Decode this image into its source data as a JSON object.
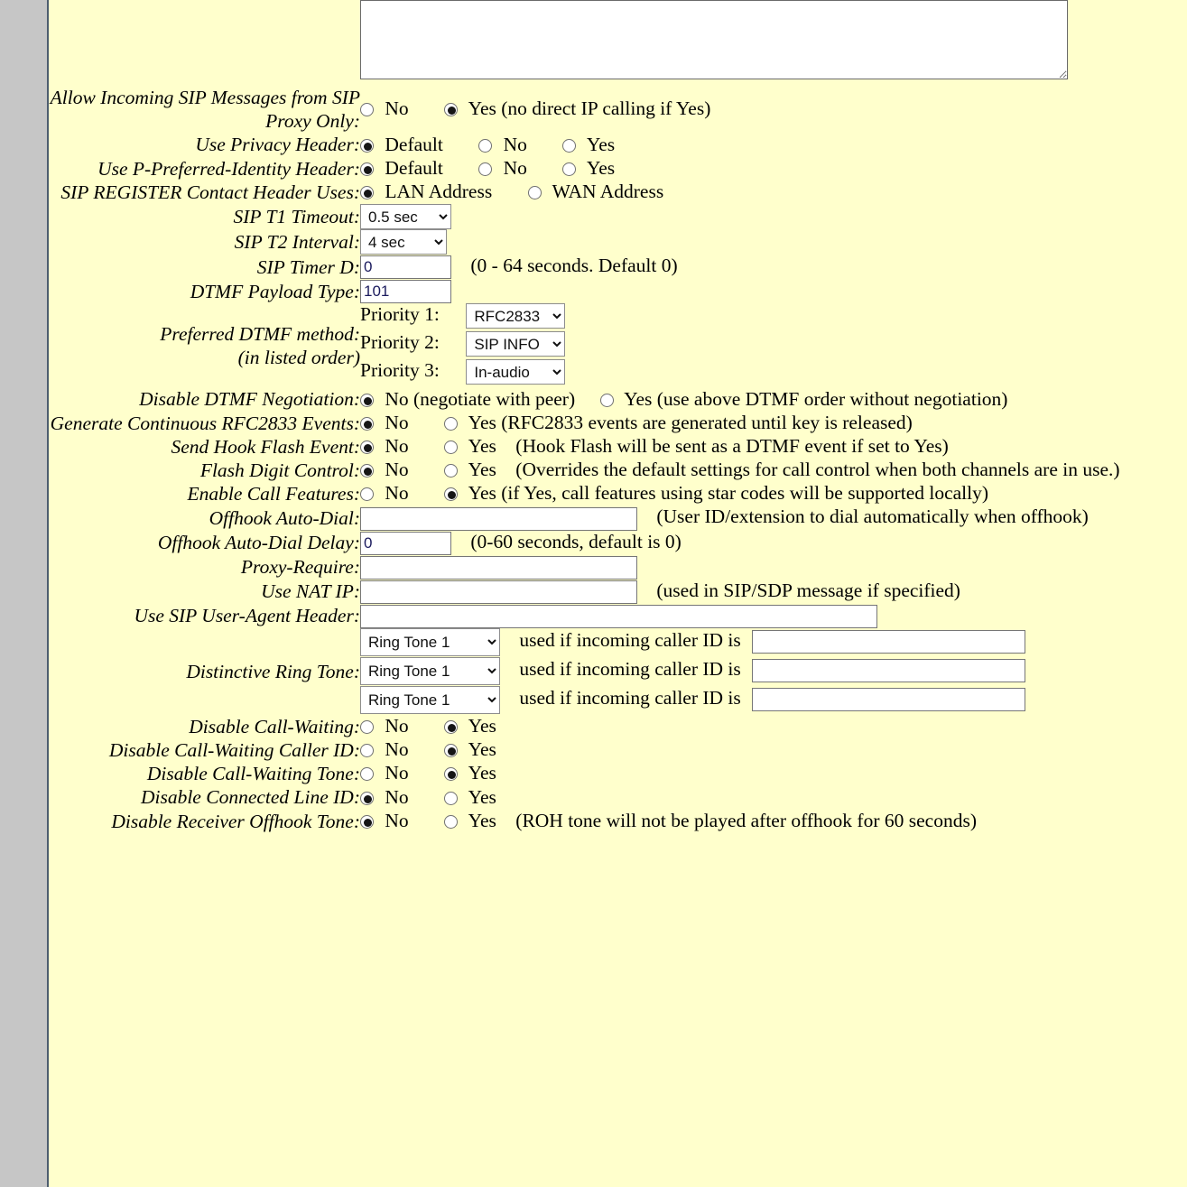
{
  "rows": {
    "allow_incoming": {
      "label": "Allow Incoming SIP Messages from SIP Proxy Only:",
      "no": "No",
      "yes": "Yes (no direct IP calling if Yes)"
    },
    "privacy_header": {
      "label": "Use Privacy Header:",
      "default": "Default",
      "no": "No",
      "yes": "Yes"
    },
    "ppi_header": {
      "label": "Use P-Preferred-Identity Header:",
      "default": "Default",
      "no": "No",
      "yes": "Yes"
    },
    "register_contact": {
      "label": "SIP REGISTER Contact Header Uses:",
      "lan": "LAN Address",
      "wan": "WAN Address"
    },
    "sip_t1": {
      "label": "SIP T1 Timeout:",
      "value": "0.5 sec"
    },
    "sip_t2": {
      "label": "SIP T2 Interval:",
      "value": "4 sec"
    },
    "sip_timer_d": {
      "label": "SIP Timer D:",
      "value": "0",
      "hint": "(0 - 64 seconds. Default 0)"
    },
    "dtmf_payload": {
      "label": "DTMF Payload Type:",
      "value": "101"
    },
    "preferred_dtmf": {
      "label": "Preferred DTMF method:",
      "label2": "(in listed order)",
      "priority1_label": "Priority 1:",
      "priority1_value": "RFC2833",
      "priority2_label": "Priority 2:",
      "priority2_value": "SIP INFO",
      "priority3_label": "Priority 3:",
      "priority3_value": "In-audio"
    },
    "disable_dtmf_neg": {
      "label": "Disable DTMF Negotiation:",
      "no": "No (negotiate with peer)",
      "yes": "Yes (use above DTMF order without negotiation)"
    },
    "continuous_rfc2833": {
      "label": "Generate Continuous RFC2833 Events:",
      "no": "No",
      "yes": "Yes (RFC2833 events are generated until key is released)"
    },
    "hook_flash": {
      "label": "Send Hook Flash Event:",
      "no": "No",
      "yes": "Yes",
      "hint": "(Hook Flash will be sent as a DTMF event if set to Yes)"
    },
    "flash_digit": {
      "label": "Flash Digit Control:",
      "no": "No",
      "yes": "Yes",
      "hint": "(Overrides the default settings for call control when both channels are in use.)"
    },
    "call_features": {
      "label": "Enable Call Features:",
      "no": "No",
      "yes": "Yes (if Yes, call features using star codes will be supported locally)"
    },
    "offhook_autodial": {
      "label": "Offhook Auto-Dial:",
      "value": "",
      "hint": "(User ID/extension to dial automatically when offhook)"
    },
    "offhook_delay": {
      "label": "Offhook Auto-Dial Delay:",
      "value": "0",
      "hint": "(0-60 seconds, default is 0)"
    },
    "proxy_require": {
      "label": "Proxy-Require:",
      "value": ""
    },
    "use_nat_ip": {
      "label": "Use NAT IP:",
      "value": "",
      "hint": "(used in SIP/SDP message if specified)"
    },
    "user_agent": {
      "label": "Use SIP User-Agent Header:",
      "value": ""
    },
    "distinctive_ring": {
      "label": "Distinctive Ring Tone:",
      "caller_id_text": "used if incoming caller ID is",
      "entries": [
        {
          "tone": "Ring Tone 1",
          "caller_id": ""
        },
        {
          "tone": "Ring Tone 1",
          "caller_id": ""
        },
        {
          "tone": "Ring Tone 1",
          "caller_id": ""
        }
      ]
    },
    "disable_cw": {
      "label": "Disable Call-Waiting:",
      "no": "No",
      "yes": "Yes"
    },
    "disable_cw_cid": {
      "label": "Disable Call-Waiting Caller ID:",
      "no": "No",
      "yes": "Yes"
    },
    "disable_cw_tone": {
      "label": "Disable Call-Waiting Tone:",
      "no": "No",
      "yes": "Yes"
    },
    "disable_connected_line_id": {
      "label": "Disable Connected Line ID:",
      "no": "No",
      "yes": "Yes"
    },
    "disable_roh_tone": {
      "label": "Disable Receiver Offhook Tone:",
      "no": "No",
      "yes": "Yes",
      "hint": "(ROH tone will not be played after offhook for 60 seconds)"
    },
    "textarea_top": {
      "value": ""
    }
  },
  "colors": {
    "page_background": "#ffffcc",
    "gutter": "#c6c6c6",
    "gutter_edge": "#4d5d70",
    "input_text": "#1b1b5e"
  }
}
